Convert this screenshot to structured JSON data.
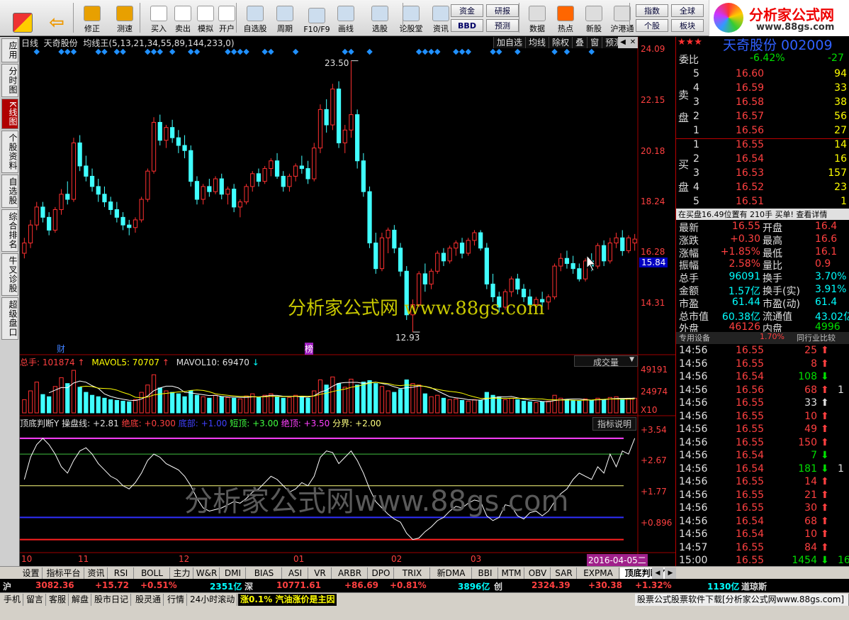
{
  "toolbar": {
    "buttons": [
      {
        "name": "home-button",
        "label": "",
        "icon": "home-icon"
      },
      {
        "name": "back-button",
        "label": "",
        "icon": "back-arrow-icon"
      },
      {
        "name": "fix-button",
        "label": "修正",
        "icon": "fix-icon"
      },
      {
        "name": "measure-button",
        "label": "测速",
        "icon": "clock-icon"
      },
      {
        "name": "buy-button",
        "label": "买入",
        "icon": "buy-icon"
      },
      {
        "name": "sell-button",
        "label": "卖出",
        "icon": "sell-icon"
      },
      {
        "name": "simulate-button",
        "label": "模拟",
        "icon": "hammer-icon"
      },
      {
        "name": "open-account-button",
        "label": "开户",
        "icon": "lock-icon"
      },
      {
        "name": "watchlist-button",
        "label": "自选股",
        "icon": "watchlist-icon"
      },
      {
        "name": "period-button",
        "label": "周期",
        "icon": "period-icon"
      },
      {
        "name": "f10-button",
        "label": "F10/F9",
        "icon": "f10-icon"
      },
      {
        "name": "draw-button",
        "label": "画线",
        "icon": "pen-icon"
      },
      {
        "name": "select-stock-button",
        "label": "选股",
        "icon": "select-icon"
      },
      {
        "name": "forum-button",
        "label": "论股堂",
        "icon": "forum-icon"
      },
      {
        "name": "info-button",
        "label": "资讯",
        "icon": "info-icon"
      },
      {
        "name": "data-button",
        "label": "数据",
        "icon": "pe-icon"
      },
      {
        "name": "hot-button",
        "label": "热点",
        "icon": "fire-icon"
      },
      {
        "name": "new-stock-button",
        "label": "新股",
        "icon": "new-stock-icon"
      },
      {
        "name": "hk-connect-button",
        "label": "沪港通",
        "icon": "hk-icon"
      }
    ],
    "square_buttons": [
      "资金",
      "研报",
      "BBD",
      "预测",
      "指数",
      "全球",
      "个股",
      "板块"
    ],
    "logo_text": "分析家公式网",
    "logo_url": "www.88gs.com"
  },
  "nav": [
    "应用",
    "分时图",
    "K线图",
    "个股资料",
    "自选股",
    "综合排名",
    "牛叉诊股",
    "超级盘口"
  ],
  "chart_header": {
    "period": "日线",
    "stock": "天奇股份",
    "indicator": "均线王(5,13,21,34,55,89,144,233,0)",
    "buttons": [
      "加自选",
      "均线",
      "除权",
      "叠",
      "窗",
      "预测"
    ]
  },
  "price_axis": [
    "24.09",
    "22.15",
    "20.18",
    "18.24",
    "16.28",
    "15.84",
    "14.31"
  ],
  "price_labels": {
    "high": "23.50",
    "low": "12.93"
  },
  "markers": {
    "cai": "财",
    "bang": "榜"
  },
  "volume_header": {
    "total": "总手: 101874",
    "mavol5": "MAVOL5: 70707",
    "mavol10": "MAVOL10: 69470",
    "dropdown": "成交量"
  },
  "volume_axis": [
    "49191",
    "24974",
    "X10"
  ],
  "indicator_header": {
    "name": "顶底判断Y",
    "line": "操盘线: +2.81",
    "juedi": "绝底: +0.300",
    "dibu": "底部: +1.00",
    "duanding": "短顶: +3.00",
    "jueding": "绝顶: +3.50",
    "fenjie": "分界: +2.00",
    "help": "指标说明"
  },
  "indicator_axis": [
    "+3.54",
    "+2.67",
    "+1.77",
    "+0.896"
  ],
  "date_axis": [
    "10",
    "11",
    "12",
    "01",
    "02",
    "03"
  ],
  "date_box": "2016-04-05二",
  "watermark1": "分析家公式网  www.88gs.com",
  "watermark2": "分析家公式网www.88gs.com",
  "quote": {
    "title": "天奇股份 002009",
    "weibi_label": "委比",
    "weibi": "-6.42%",
    "weicha": "-27",
    "sell_label": "卖\n盘",
    "buy_label": "买\n盘",
    "asks": [
      {
        "lvl": "5",
        "p": "16.60",
        "v": "94"
      },
      {
        "lvl": "4",
        "p": "16.59",
        "v": "33"
      },
      {
        "lvl": "3",
        "p": "16.58",
        "v": "38"
      },
      {
        "lvl": "2",
        "p": "16.57",
        "v": "56"
      },
      {
        "lvl": "1",
        "p": "16.56",
        "v": "27"
      }
    ],
    "bids": [
      {
        "lvl": "1",
        "p": "16.55",
        "v": "14"
      },
      {
        "lvl": "2",
        "p": "16.54",
        "v": "16"
      },
      {
        "lvl": "3",
        "p": "16.53",
        "v": "157"
      },
      {
        "lvl": "4",
        "p": "16.52",
        "v": "23"
      },
      {
        "lvl": "5",
        "p": "16.51",
        "v": "1"
      }
    ],
    "notice": "在买盘16.49位置有 210手 买单! 查看详情",
    "stats": [
      [
        "最新",
        "16.55",
        "开盘",
        "16.4"
      ],
      [
        "涨跌",
        "+0.30",
        "最高",
        "16.6"
      ],
      [
        "涨幅",
        "+1.85%",
        "最低",
        "16.1"
      ],
      [
        "振幅",
        "2.58%",
        "量比",
        "0.9"
      ],
      [
        "总手",
        "96091",
        "换手",
        "3.70%"
      ],
      [
        "金额",
        "1.57亿",
        "换手(实)",
        "3.91%"
      ],
      [
        "市盈",
        "61.44",
        "市盈(动)",
        "61.4"
      ],
      [
        "总市值",
        "60.38亿",
        "流通值",
        "43.02亿"
      ],
      [
        "外盘",
        "46126",
        "内盘",
        "4996"
      ]
    ],
    "industry_label": "专用设备",
    "industry_pct": "1.70%",
    "compare": "同行业比较",
    "ticks": [
      [
        "14:56",
        "16.55",
        "25",
        "up"
      ],
      [
        "14:56",
        "16.55",
        "8",
        "up"
      ],
      [
        "14:56",
        "16.54",
        "108",
        "dn"
      ],
      [
        "14:56",
        "16.56",
        "68",
        "up"
      ],
      [
        "14:56",
        "16.55",
        "33",
        "wt"
      ],
      [
        "14:56",
        "16.55",
        "10",
        "up"
      ],
      [
        "14:56",
        "16.55",
        "49",
        "up"
      ],
      [
        "14:56",
        "16.55",
        "150",
        "up"
      ],
      [
        "14:56",
        "16.54",
        "7",
        "dn"
      ],
      [
        "14:56",
        "16.54",
        "181",
        "dn"
      ],
      [
        "14:56",
        "16.55",
        "14",
        "up"
      ],
      [
        "14:56",
        "16.55",
        "21",
        "up"
      ],
      [
        "14:56",
        "16.55",
        "30",
        "up"
      ],
      [
        "14:56",
        "16.54",
        "68",
        "up"
      ],
      [
        "14:56",
        "16.54",
        "10",
        "up"
      ],
      [
        "14:57",
        "16.55",
        "84",
        "up"
      ],
      [
        "15:00",
        "16.55",
        "1454",
        "dn"
      ]
    ],
    "tick_extra": [
      "1",
      "1",
      "16"
    ],
    "rtabs": [
      "细",
      "诊",
      "分",
      "筹",
      "焰",
      "指",
      "财"
    ]
  },
  "bottom_tabs": [
    "设置",
    "指标平台",
    "资讯",
    "RSI",
    "BOLL",
    "主力",
    "W&R",
    "DMI",
    "BIAS",
    "ASI",
    "VR",
    "ARBR",
    "DPO",
    "TRIX",
    "新DMA",
    "BBI",
    "MTM",
    "OBV",
    "SAR",
    "EXPMA",
    "顶底判断Y"
  ],
  "index_bar": {
    "sh": "沪",
    "sh_val": "3082.36",
    "sh_chg": "+15.72",
    "sh_pct": "+0.51%",
    "sh_amt": "2351亿",
    "sz": "深",
    "sz_val": "10771.61",
    "sz_chg": "+86.69",
    "sz_pct": "+0.81%",
    "sz_amt": "3896亿",
    "cy": "创",
    "cy_val": "2324.39",
    "cy_chg": "+30.38",
    "cy_pct": "+1.32%",
    "dj_amt": "1130亿",
    "dj": "道琼斯"
  },
  "status": {
    "items": [
      "手机",
      "留言",
      "客服",
      "解盘",
      "股市日记",
      "股灵通",
      "行情",
      "24小时滚动"
    ],
    "news": "涨0.1% 汽油涨价是主因",
    "right": "股票公式股票软件下载[分析家公式网www.88gs.com]"
  },
  "colors": {
    "up": "#ff3030",
    "down": "#40ffff",
    "ma": "#ff40ff",
    "bg": "#000000"
  },
  "chart_data": {
    "type": "candlestick",
    "price_range": [
      12.5,
      24.3
    ],
    "candles": [
      [
        16.0,
        16.6,
        15.8,
        16.4
      ],
      [
        16.4,
        17.3,
        16.2,
        17.1
      ],
      [
        17.1,
        18.0,
        16.9,
        17.8
      ],
      [
        17.8,
        18.0,
        17.2,
        17.4
      ],
      [
        17.4,
        17.6,
        16.7,
        16.9
      ],
      [
        16.9,
        17.8,
        16.8,
        17.7
      ],
      [
        17.7,
        18.5,
        17.5,
        18.3
      ],
      [
        18.3,
        18.8,
        17.9,
        18.1
      ],
      [
        18.1,
        20.5,
        18.0,
        20.3
      ],
      [
        20.3,
        20.6,
        19.2,
        19.4
      ],
      [
        19.4,
        19.8,
        18.8,
        19.0
      ],
      [
        19.0,
        19.3,
        18.4,
        18.6
      ],
      [
        18.6,
        18.9,
        18.0,
        18.3
      ],
      [
        18.3,
        18.6,
        17.8,
        18.0
      ],
      [
        18.0,
        18.2,
        17.5,
        17.7
      ],
      [
        17.7,
        18.0,
        17.2,
        17.4
      ],
      [
        17.4,
        17.6,
        16.9,
        17.1
      ],
      [
        17.1,
        17.3,
        16.7,
        17.0
      ],
      [
        17.0,
        17.4,
        16.8,
        17.3
      ],
      [
        17.3,
        18.2,
        17.2,
        18.1
      ],
      [
        18.1,
        19.3,
        18.0,
        19.2
      ],
      [
        19.2,
        21.3,
        19.1,
        21.1
      ],
      [
        21.1,
        21.4,
        20.2,
        20.4
      ],
      [
        20.4,
        21.0,
        20.1,
        20.9
      ],
      [
        20.9,
        21.2,
        20.3,
        20.5
      ],
      [
        20.5,
        20.8,
        19.9,
        20.2
      ],
      [
        20.2,
        20.6,
        19.7,
        20.0
      ],
      [
        20.0,
        20.2,
        18.6,
        18.8
      ],
      [
        18.8,
        19.0,
        17.9,
        18.1
      ],
      [
        18.1,
        18.7,
        17.9,
        18.6
      ],
      [
        18.6,
        18.9,
        18.2,
        18.4
      ],
      [
        18.4,
        19.0,
        18.3,
        18.9
      ],
      [
        18.9,
        19.1,
        18.1,
        18.3
      ],
      [
        18.3,
        18.6,
        17.9,
        18.5
      ],
      [
        18.5,
        18.7,
        17.6,
        17.8
      ],
      [
        17.8,
        18.1,
        17.4,
        18.0
      ],
      [
        18.0,
        18.7,
        17.9,
        18.6
      ],
      [
        18.6,
        19.2,
        18.4,
        19.1
      ],
      [
        19.1,
        19.3,
        18.6,
        18.8
      ],
      [
        18.8,
        19.4,
        18.7,
        19.3
      ],
      [
        19.3,
        19.7,
        19.0,
        19.6
      ],
      [
        19.6,
        19.9,
        18.9,
        19.0
      ],
      [
        19.0,
        19.2,
        18.4,
        18.6
      ],
      [
        18.6,
        19.1,
        18.4,
        19.0
      ],
      [
        19.0,
        19.5,
        18.8,
        19.4
      ],
      [
        19.4,
        19.8,
        19.1,
        19.3
      ],
      [
        19.3,
        19.6,
        18.7,
        18.9
      ],
      [
        18.9,
        20.3,
        18.8,
        20.1
      ],
      [
        20.1,
        21.8,
        19.9,
        21.6
      ],
      [
        21.6,
        22.0,
        20.7,
        21.0
      ],
      [
        21.0,
        22.6,
        20.8,
        22.4
      ],
      [
        22.4,
        22.7,
        20.1,
        20.3
      ],
      [
        20.3,
        21.0,
        19.9,
        20.8
      ],
      [
        20.8,
        23.5,
        20.5,
        21.4
      ],
      [
        21.4,
        21.6,
        19.3,
        19.6
      ],
      [
        19.6,
        19.9,
        18.2,
        18.4
      ],
      [
        18.4,
        18.6,
        16.2,
        16.4
      ],
      [
        16.4,
        16.8,
        15.2,
        15.4
      ],
      [
        15.4,
        16.8,
        15.3,
        16.6
      ],
      [
        16.6,
        17.0,
        16.0,
        16.9
      ],
      [
        16.9,
        17.1,
        16.0,
        16.2
      ],
      [
        16.2,
        16.4,
        15.1,
        15.3
      ],
      [
        15.3,
        15.5,
        13.4,
        13.6
      ],
      [
        13.6,
        14.2,
        12.93,
        14.0
      ],
      [
        14.0,
        15.3,
        13.9,
        15.2
      ],
      [
        15.2,
        15.6,
        14.5,
        14.8
      ],
      [
        14.8,
        15.4,
        14.6,
        15.3
      ],
      [
        15.3,
        16.1,
        15.2,
        16.0
      ],
      [
        16.0,
        16.2,
        15.5,
        15.7
      ],
      [
        15.7,
        16.3,
        15.6,
        16.2
      ],
      [
        16.2,
        16.5,
        15.9,
        16.4
      ],
      [
        16.4,
        16.6,
        15.8,
        16.0
      ],
      [
        16.0,
        16.6,
        15.9,
        16.5
      ],
      [
        16.5,
        16.9,
        16.3,
        16.8
      ],
      [
        16.8,
        16.9,
        16.1,
        16.2
      ],
      [
        16.2,
        16.4,
        14.6,
        14.8
      ],
      [
        14.8,
        15.2,
        14.1,
        14.3
      ],
      [
        14.3,
        14.5,
        13.7,
        13.9
      ],
      [
        13.9,
        14.6,
        13.8,
        14.5
      ],
      [
        14.5,
        15.1,
        14.3,
        15.0
      ],
      [
        15.0,
        15.2,
        14.4,
        14.6
      ],
      [
        14.6,
        14.8,
        14.1,
        14.3
      ],
      [
        14.3,
        14.6,
        13.8,
        14.0
      ],
      [
        14.0,
        14.3,
        13.9,
        14.2
      ],
      [
        14.2,
        14.5,
        13.9,
        14.1
      ],
      [
        14.1,
        14.4,
        13.8,
        14.3
      ],
      [
        14.3,
        15.6,
        14.2,
        15.5
      ],
      [
        15.5,
        16.0,
        15.3,
        15.8
      ],
      [
        15.8,
        16.1,
        15.4,
        15.6
      ],
      [
        15.6,
        15.9,
        15.2,
        15.4
      ],
      [
        15.4,
        15.6,
        14.9,
        15.0
      ],
      [
        15.0,
        15.8,
        14.9,
        15.7
      ],
      [
        15.7,
        16.0,
        15.3,
        15.5
      ],
      [
        15.5,
        16.4,
        15.4,
        16.3
      ],
      [
        16.3,
        16.5,
        15.5,
        15.7
      ],
      [
        15.7,
        16.6,
        15.6,
        16.4
      ],
      [
        16.4,
        16.8,
        16.2,
        16.6
      ],
      [
        16.6,
        16.9,
        15.9,
        16.1
      ],
      [
        16.1,
        16.7,
        16.0,
        16.6
      ],
      [
        16.4,
        16.75,
        16.1,
        16.55
      ]
    ],
    "volumes": [
      18,
      30,
      42,
      25,
      22,
      36,
      48,
      40,
      58,
      35,
      28,
      24,
      22,
      20,
      18,
      17,
      16,
      15,
      18,
      28,
      38,
      52,
      34,
      30,
      28,
      26,
      22,
      30,
      24,
      22,
      20,
      24,
      22,
      21,
      20,
      19,
      23,
      26,
      21,
      24,
      26,
      22,
      20,
      21,
      24,
      22,
      20,
      30,
      45,
      38,
      49,
      40,
      35,
      46,
      38,
      42,
      44,
      40,
      36,
      30,
      28,
      32,
      45,
      40,
      38,
      26,
      22,
      24,
      20,
      18,
      19,
      17,
      16,
      18,
      17,
      28,
      24,
      22,
      18,
      20,
      18,
      16,
      15,
      14,
      15,
      16,
      24,
      20,
      18,
      17,
      16,
      19,
      17,
      20,
      18,
      21,
      22,
      18,
      20,
      20
    ],
    "osc_range": [
      0,
      3.9
    ],
    "osc": [
      2.2,
      2.9,
      3.3,
      3.5,
      3.3,
      3.0,
      2.6,
      2.4,
      2.8,
      3.1,
      3.2,
      3.0,
      2.7,
      2.5,
      2.3,
      2.2,
      2.0,
      1.9,
      2.1,
      2.4,
      2.8,
      3.0,
      2.9,
      2.7,
      2.6,
      2.5,
      2.3,
      2.0,
      1.6,
      1.3,
      1.2,
      1.25,
      1.3,
      1.4,
      1.5,
      1.45,
      1.6,
      1.8,
      1.9,
      2.1,
      2.3,
      2.2,
      2.0,
      1.8,
      1.9,
      2.1,
      2.0,
      2.3,
      2.9,
      3.1,
      3.05,
      2.7,
      2.9,
      3.1,
      2.8,
      2.4,
      1.9,
      1.5,
      1.3,
      1.1,
      0.95,
      0.85,
      0.5,
      0.3,
      0.35,
      0.55,
      0.7,
      0.9,
      1.0,
      1.2,
      1.35,
      1.3,
      1.45,
      1.55,
      1.5,
      1.05,
      0.9,
      1.0,
      1.4,
      1.35,
      1.05,
      0.95,
      1.15,
      1.2,
      1.05,
      1.2,
      1.5,
      1.75,
      1.9,
      2.2,
      2.4,
      2.3,
      2.2,
      2.6,
      2.4,
      3.0,
      2.6,
      3.1,
      3.0,
      3.5
    ],
    "levels": {
      "jueding": 3.5,
      "duanding": 3.0,
      "fenjie": 2.0,
      "dibu": 1.0,
      "juedi": 0.3
    },
    "ma_series": "MA5 (white), MA10 (yellow) on volume"
  }
}
